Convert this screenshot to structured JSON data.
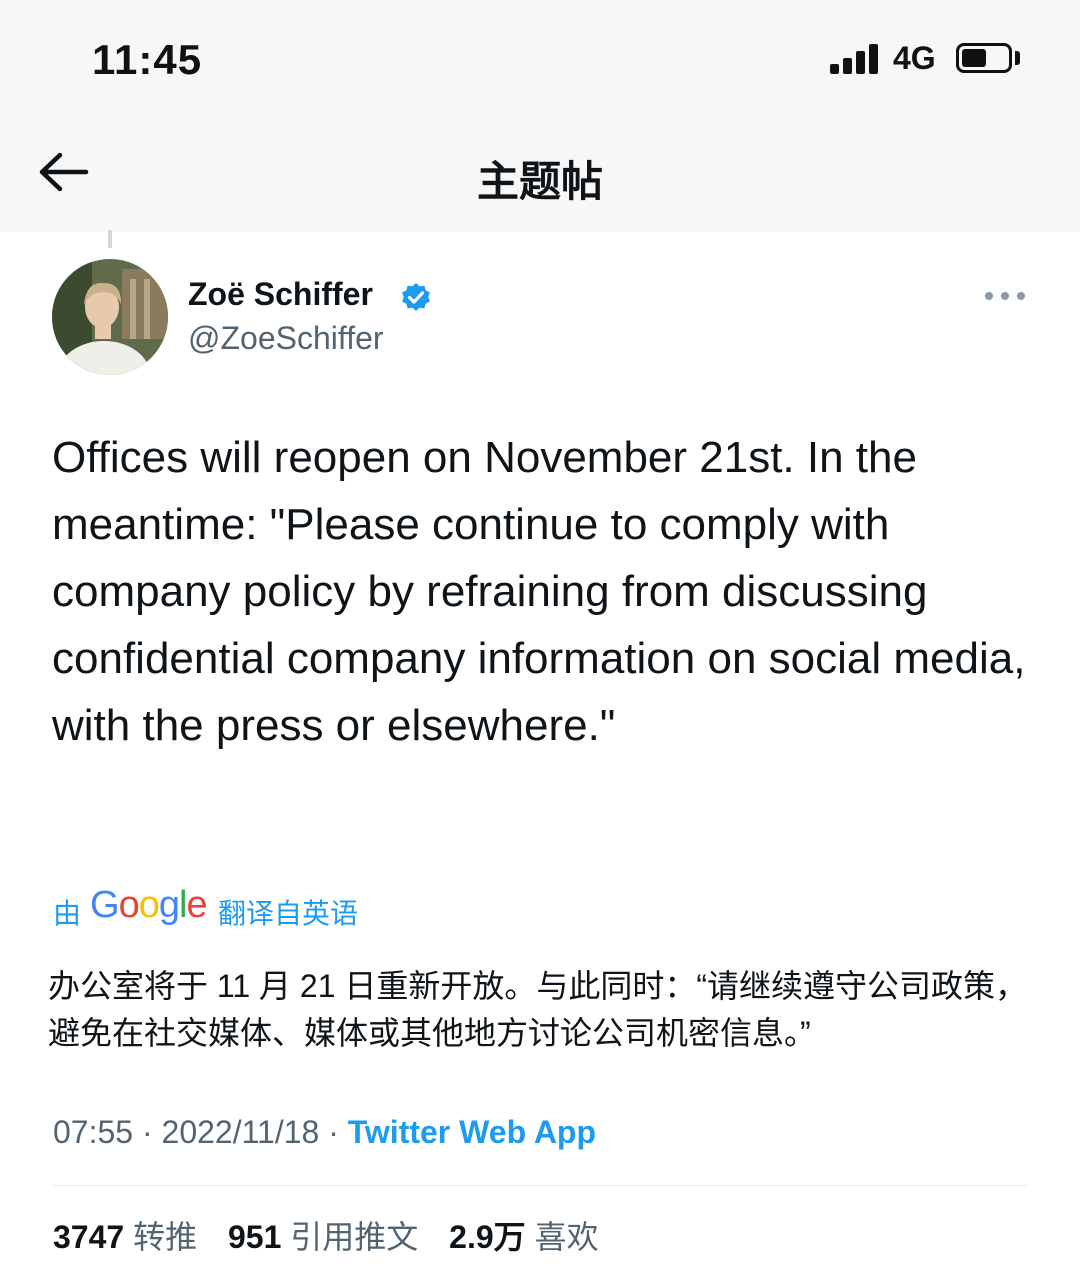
{
  "status_bar": {
    "time": "11:45",
    "network": "4G",
    "battery_level": 0.55,
    "signal_icon": "signal-bars-icon",
    "battery_icon": "battery-icon"
  },
  "nav": {
    "title": "主题帖",
    "back_icon": "arrow-left-icon"
  },
  "tweet": {
    "display_name": "Zoë Schiffer",
    "handle": "@ZoeSchiffer",
    "verified_icon": "verified-badge-icon",
    "more_icon": "more-horizontal-icon",
    "text": "Offices will reopen on November 21st. In the meantime: \"Please continue to comply with company policy by refraining from discussing confidential company information on social media, with the press or elsewhere.\"",
    "translation": {
      "prefix": "由",
      "provider_logo": "Google",
      "suffix": "翻译自英语",
      "text": "办公室将于 11 月 21 日重新开放。与此同时：“请继续遵守公司政策，避免在社交媒体、媒体或其他地方讨论公司机密信息。”"
    },
    "time": "07:55",
    "separator": "·",
    "date": "2022/11/18",
    "source": "Twitter Web App",
    "stats": {
      "retweets_count": "3747",
      "retweets_label": "转推",
      "quotes_count": "951",
      "quotes_label": "引用推文",
      "likes_count": "2.9万",
      "likes_label": "喜欢"
    }
  },
  "colors": {
    "accent": "#1d9bf0",
    "text_primary": "#0f1419",
    "text_secondary": "#536471",
    "header_bg": "#f7f7f7"
  }
}
